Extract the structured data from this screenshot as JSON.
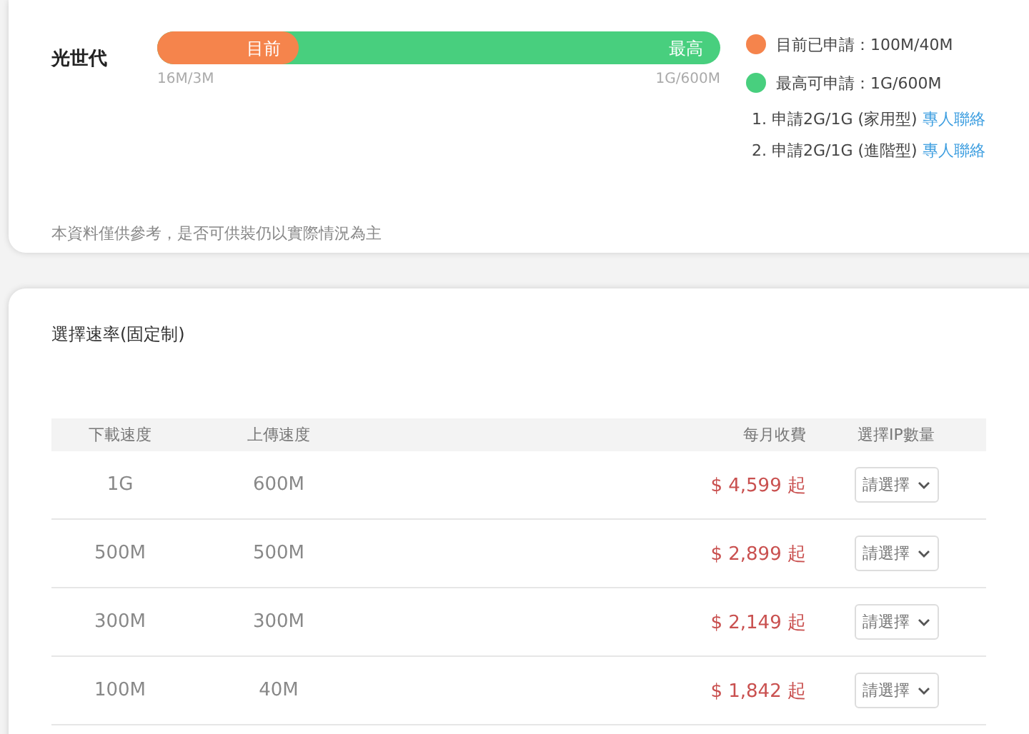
{
  "plan": {
    "name": "光世代",
    "bar": {
      "level": 0.25,
      "current_label": "目前",
      "max_label": "最高",
      "min_reading": "16M/3M",
      "max_reading": "1G/600M"
    },
    "legend": [
      {
        "color": "#f5844c",
        "text": "目前已申請：100M/40M"
      },
      {
        "color": "#48cf7e",
        "text": "最高可申請：1G/600M"
      }
    ],
    "notes": [
      {
        "text": "1. 申請2G/1G (家用型)",
        "link": "專人聯絡"
      },
      {
        "text": "2. 申請2G/1G (進階型)",
        "link": "專人聯絡"
      }
    ],
    "disclaimer": "本資料僅供參考，是否可供裝仍以實際情況為主"
  },
  "rates": {
    "title": "選擇速率(固定制)",
    "columns": [
      "下載速度",
      "上傳速度",
      "每月收費",
      "選擇IP數量"
    ],
    "rows": [
      {
        "download": "1G",
        "upload": "600M",
        "price": "$ 4,599 起",
        "ip_select": "請選擇"
      },
      {
        "download": "500M",
        "upload": "500M",
        "price": "$ 2,899 起",
        "ip_select": "請選擇"
      },
      {
        "download": "300M",
        "upload": "300M",
        "price": "$ 2,149 起",
        "ip_select": "請選擇"
      },
      {
        "download": "100M",
        "upload": "40M",
        "price": "$ 1,842 起",
        "ip_select": "請選擇"
      }
    ]
  }
}
